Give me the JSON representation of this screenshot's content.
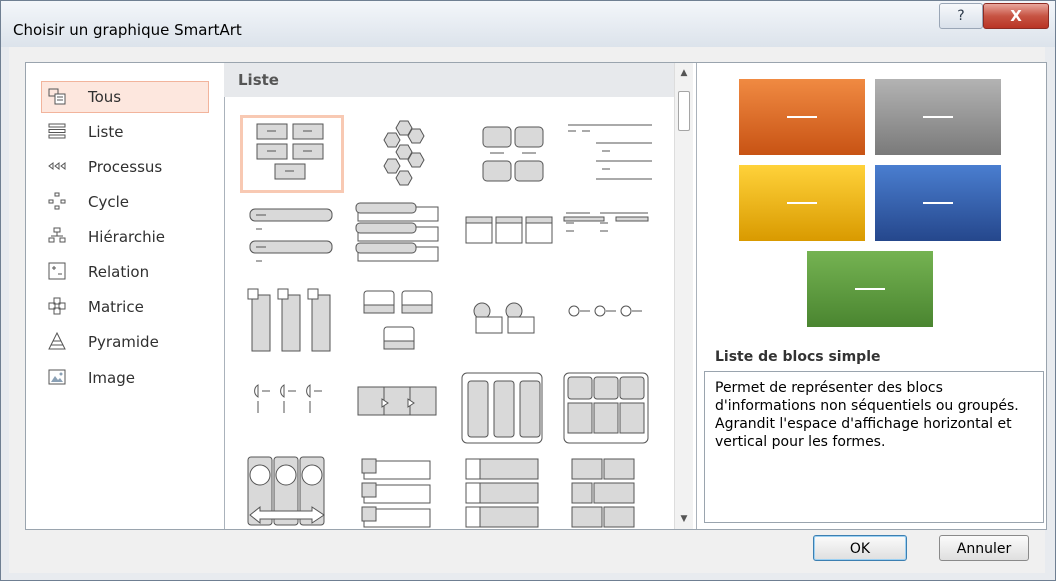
{
  "window": {
    "title": "Choisir un graphique SmartArt",
    "help_glyph": "?",
    "close_glyph": "X"
  },
  "categories": [
    {
      "label": "Tous",
      "icon": "all-layouts-icon",
      "selected": true
    },
    {
      "label": "Liste",
      "icon": "list-icon"
    },
    {
      "label": "Processus",
      "icon": "process-icon"
    },
    {
      "label": "Cycle",
      "icon": "cycle-icon"
    },
    {
      "label": "Hiérarchie",
      "icon": "hierarchy-icon"
    },
    {
      "label": "Relation",
      "icon": "relationship-icon"
    },
    {
      "label": "Matrice",
      "icon": "matrix-icon"
    },
    {
      "label": "Pyramide",
      "icon": "pyramid-icon"
    },
    {
      "label": "Image",
      "icon": "picture-icon"
    }
  ],
  "gallery": {
    "section_title": "Liste",
    "layouts": [
      "basic-block-list",
      "hexagon-cluster",
      "grouped-blocks",
      "lined-list",
      "vertical-bullet-list",
      "stacked-list",
      "table-list",
      "horizontal-bullet-list",
      "vertical-box-list",
      "trapezoid-list",
      "circle-accent-list",
      "bullet-line-list",
      "accent-process-list",
      "chevron-list",
      "vertical-boxes",
      "grid-matrix-list",
      "circle-arrow-list",
      "tab-list",
      "vertical-table-list",
      "brick-list"
    ],
    "selected_index": 0
  },
  "preview": {
    "name": "Liste de blocs simple",
    "description": "Permet de représenter des blocs d'informations non séquentiels ou groupés. Agrandit l'espace d'affichage horizontal et vertical pour les formes.",
    "colors": {
      "orange": "#e8702a",
      "gray": "#8c8c8c",
      "gold": "#f5b800",
      "blue": "#2f5da8",
      "green": "#5a9a3a"
    }
  },
  "buttons": {
    "ok": "OK",
    "cancel": "Annuler"
  }
}
